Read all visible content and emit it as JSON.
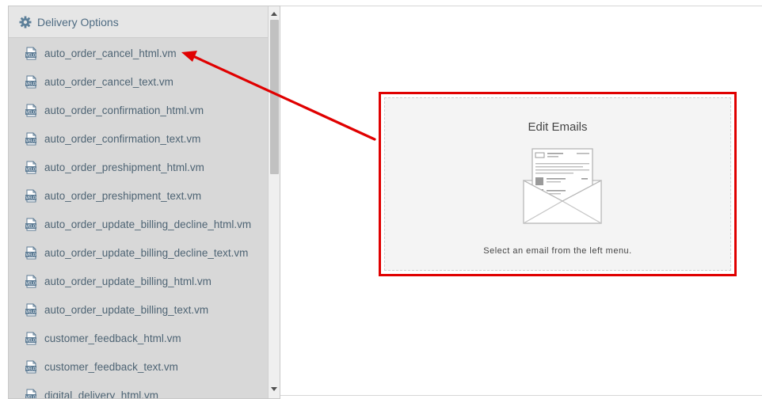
{
  "sidebar": {
    "header": {
      "icon": "gear-icon",
      "label": "Delivery Options"
    },
    "file_icon": "velocity-file-icon",
    "items": [
      {
        "label": "auto_order_cancel_html.vm"
      },
      {
        "label": "auto_order_cancel_text.vm"
      },
      {
        "label": "auto_order_confirmation_html.vm"
      },
      {
        "label": "auto_order_confirmation_text.vm"
      },
      {
        "label": "auto_order_preshipment_html.vm"
      },
      {
        "label": "auto_order_preshipment_text.vm"
      },
      {
        "label": "auto_order_update_billing_decline_html.vm"
      },
      {
        "label": "auto_order_update_billing_decline_text.vm"
      },
      {
        "label": "auto_order_update_billing_html.vm"
      },
      {
        "label": "auto_order_update_billing_text.vm"
      },
      {
        "label": "customer_feedback_html.vm"
      },
      {
        "label": "customer_feedback_text.vm"
      },
      {
        "label": "digital_delivery_html.vm"
      }
    ]
  },
  "content": {
    "title": "Edit Emails",
    "illustration": "email-envelope-icon",
    "hint": "Select an email from the left menu."
  },
  "annotation": {
    "color": "#e00000"
  },
  "colors": {
    "sidebar_bg": "#d8d8d8",
    "link_text": "#4e6474",
    "header_text": "#4e6b82",
    "card_bg": "#f4f4f4"
  }
}
